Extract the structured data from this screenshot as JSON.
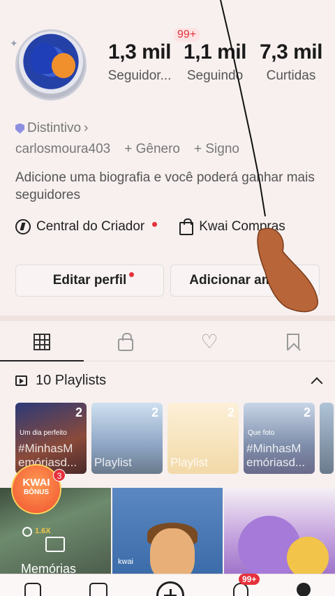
{
  "profile": {
    "username": "carlosmoura403",
    "badge_label": "Distintivo",
    "gender_link": "+ Gênero",
    "sign_link": "+ Signo",
    "bio": "Adicione uma biografia e você poderá ganhar mais seguidores"
  },
  "stats": {
    "followers_value": "1,3 mil",
    "followers_label": "Seguidor...",
    "following_value": "1,1 mil",
    "following_label": "Seguindo",
    "likes_value": "7,3 mil",
    "likes_label": "Curtidas",
    "notif_badge": "99+"
  },
  "links": {
    "creator_center": "Central do Criador",
    "kwai_shop": "Kwai Compras"
  },
  "buttons": {
    "edit_profile": "Editar perfil",
    "add_friends": "Adicionar amigos"
  },
  "playlists": {
    "header": "10 Playlists",
    "items": [
      {
        "count": "2",
        "title": "#MinhasM emóriasd...",
        "subtitle": "Um dia perfeito"
      },
      {
        "count": "2",
        "title": "Playlist"
      },
      {
        "count": "2",
        "title": "Playlist"
      },
      {
        "count": "2",
        "title": "#MinhasM emóriasd...",
        "subtitle": "Que foto"
      }
    ]
  },
  "videos": [
    {
      "label": "Memórias",
      "multiplier": "1.6X"
    },
    {
      "logo": "kwai"
    },
    {
      "caption": ""
    }
  ],
  "kwai_bonus": {
    "line1": "KWAI",
    "line2": "BÔNUS",
    "badge": "3"
  },
  "bottom_nav": {
    "notif_badge": "99+"
  },
  "colors": {
    "accent_red": "#e5313b",
    "background": "#f7f0ef"
  },
  "icons": [
    "shield-icon",
    "creator-center-icon",
    "shopping-bag-icon",
    "grid-icon",
    "lock-icon",
    "heart-icon",
    "bookmark-icon",
    "playlist-icon",
    "chevron-up-icon",
    "home-icon",
    "discover-icon",
    "add-icon",
    "bell-icon",
    "profile-icon"
  ]
}
